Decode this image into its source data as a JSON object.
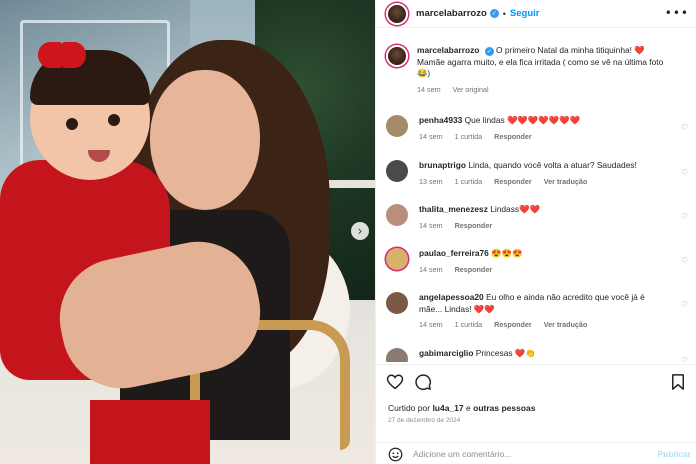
{
  "post": {
    "username": "marcelabarrozo",
    "follow_label": "Seguir",
    "more_label": "•••",
    "next_label": "›"
  },
  "caption": {
    "username": "marcelabarrozo",
    "text": "O primeiro Natal da minha titiquinha! ❤️ Mamãe agarra muito, e ela fica irritada ( como se vê na última foto 😂)",
    "time": "14 sem",
    "see_original": "Ver original"
  },
  "comments": [
    {
      "username": "penha4933",
      "text": "Que lindas ❤️❤️❤️❤️❤️❤️❤️",
      "time": "14 sem",
      "likes": "1 curtida",
      "reply": "Responder",
      "translate": "",
      "avatar_color": "#a58b6c"
    },
    {
      "username": "brunaptrigo",
      "text": "Linda, quando você volta a atuar? Saudades!",
      "time": "13 sem",
      "likes": "1 curtida",
      "reply": "Responder",
      "translate": "Ver tradução",
      "avatar_color": "#4a4a4a"
    },
    {
      "username": "thalita_menezesz",
      "text": "Lindass❤️❤️",
      "time": "14 sem",
      "likes": "",
      "reply": "Responder",
      "translate": "",
      "avatar_color": "#b98e7a"
    },
    {
      "username": "paulao_ferreira76",
      "text": "😍😍😍",
      "time": "14 sem",
      "likes": "",
      "reply": "Responder",
      "translate": "",
      "avatar_color": "#d6b26a"
    },
    {
      "username": "angelapessoa20",
      "text": "Eu olho e ainda não acredito que você já é mãe... Lindas! ❤️❤️",
      "time": "14 sem",
      "likes": "1 curtida",
      "reply": "Responder",
      "translate": "Ver tradução",
      "avatar_color": "#7a5a45"
    },
    {
      "username": "gabimarciglio",
      "text": "Princesas ❤️👏",
      "time": "",
      "likes": "",
      "reply": "",
      "translate": "",
      "avatar_color": "#8a7a72"
    }
  ],
  "footer": {
    "liked_by_prefix": "Curtido por",
    "liked_by_user": "lu4a_17",
    "liked_by_suffix": "e",
    "liked_by_others": "outras pessoas",
    "date": "27 de dezembro de 2024",
    "add_comment_placeholder": "Adicione um comentário...",
    "publish_label": "Publicar"
  },
  "icons": {
    "like": "heart-icon",
    "comment": "comment-icon",
    "save": "bookmark-icon",
    "emoji": "emoji-icon"
  },
  "colors": {
    "link_blue": "#0095f6",
    "verified_blue": "#3897f0",
    "heart_red": "#e0141e",
    "meta_gray": "#737373"
  }
}
